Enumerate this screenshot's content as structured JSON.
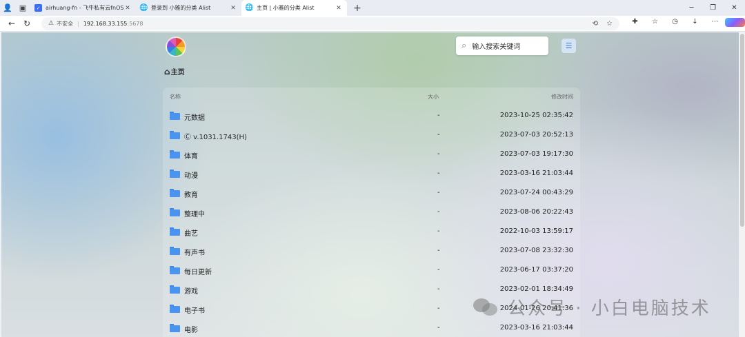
{
  "browser": {
    "tabs": [
      {
        "title": "airhuang-fn - 飞牛私有云fnOS",
        "icon": "fnos-icon",
        "active": false
      },
      {
        "title": "登录到 小雅的分类 Alist",
        "icon": "globe-icon",
        "active": false
      },
      {
        "title": "主页 | 小雅的分类 Alist",
        "icon": "globe-icon",
        "active": true
      }
    ],
    "address": {
      "security_label": "不安全",
      "host": "192.168.33.155",
      "port": ":5678"
    }
  },
  "page": {
    "search_placeholder": "输入搜索关键词",
    "breadcrumb": "主页",
    "columns": {
      "name": "名称",
      "size": "大小",
      "modified": "修改时间"
    },
    "files": [
      {
        "name": "元数据",
        "size": "-",
        "modified": "2023-10-25 02:35:42"
      },
      {
        "name": "Ⓒ v.1031.1743(H)",
        "size": "-",
        "modified": "2023-07-03 20:52:13"
      },
      {
        "name": "体育",
        "size": "-",
        "modified": "2023-07-03 19:17:30"
      },
      {
        "name": "动漫",
        "size": "-",
        "modified": "2023-03-16 21:03:44"
      },
      {
        "name": "教育",
        "size": "-",
        "modified": "2023-07-24 00:43:29"
      },
      {
        "name": "整理中",
        "size": "-",
        "modified": "2023-08-06 20:22:43"
      },
      {
        "name": "曲艺",
        "size": "-",
        "modified": "2022-10-03 13:59:17"
      },
      {
        "name": "有声书",
        "size": "-",
        "modified": "2023-07-08 23:32:30"
      },
      {
        "name": "每日更新",
        "size": "-",
        "modified": "2023-06-17 03:37:20"
      },
      {
        "name": "游戏",
        "size": "-",
        "modified": "2023-02-01 18:34:49"
      },
      {
        "name": "电子书",
        "size": "-",
        "modified": "2024-01-26 20:41:36"
      },
      {
        "name": "电影",
        "size": "-",
        "modified": "2023-03-16 21:03:44"
      }
    ]
  },
  "watermark": "公众号 · 小白电脑技术"
}
